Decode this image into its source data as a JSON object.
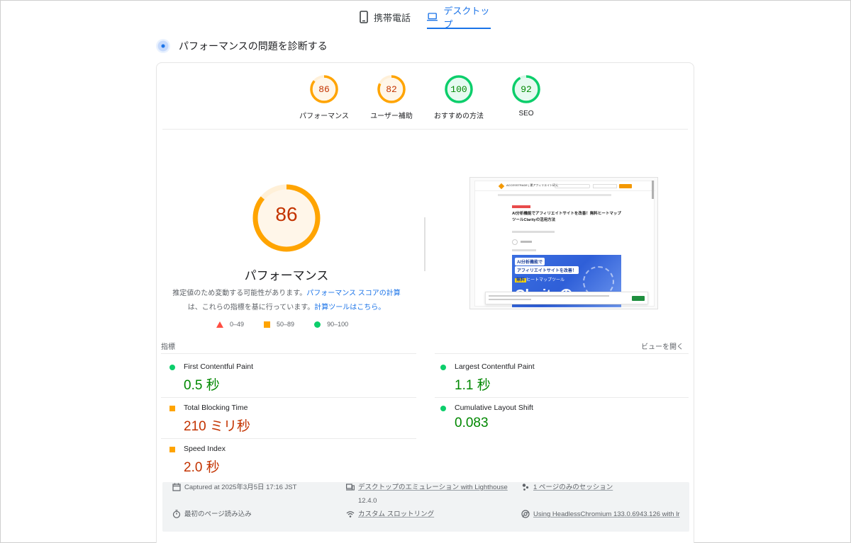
{
  "tabs": {
    "mobile": "携帯電話",
    "desktop": "デスクトップ"
  },
  "diagnose_title": "パフォーマンスの問題を診断する",
  "scores": [
    {
      "label": "パフォーマンス",
      "value": "86",
      "level": "average"
    },
    {
      "label": "ユーザー補助",
      "value": "82",
      "level": "average"
    },
    {
      "label": "おすすめの方法",
      "value": "100",
      "level": "pass"
    },
    {
      "label": "SEO",
      "value": "92",
      "level": "pass"
    }
  ],
  "main_score": {
    "value": "86",
    "title": "パフォーマンス"
  },
  "description": {
    "line1": "推定値のため変動する可能性があります。",
    "link1": "パフォーマンス スコアの計算",
    "line2": "は、これらの指標を基に行っています。",
    "link2": "計算ツールはこちら。"
  },
  "legend": {
    "fail": "0–49",
    "average": "50–89",
    "pass": "90–100"
  },
  "screenshot": {
    "brand": "ACCESSTRADE | 運アフィリエイト研究",
    "title": "AI分析機能でアフィリエイトサイトを改善！無料ヒートマップツールClarityの活用方法",
    "hero1": "AI分析機能で",
    "hero2": "アフィリエイトサイトを改善！",
    "hero_badge": "無料",
    "hero3": "ヒートマップツール",
    "hero4": "Clarityの"
  },
  "metrics": {
    "heading": "指標",
    "expand": "ビューを開く",
    "items": [
      {
        "name": "First Contentful Paint",
        "value": "0.5 秒",
        "level": "pass"
      },
      {
        "name": "Largest Contentful Paint",
        "value": "1.1 秒",
        "level": "pass"
      },
      {
        "name": "Total Blocking Time",
        "value": "210 ミリ秒",
        "level": "average"
      },
      {
        "name": "Cumulative Layout Shift",
        "value": "0.083",
        "level": "pass"
      },
      {
        "name": "Speed Index",
        "value": "2.0 秒",
        "level": "average"
      }
    ]
  },
  "info": {
    "captured": "Captured at 2025年3月5日 17:16 JST",
    "emulation": "デスクトップのエミュレーション with Lighthouse",
    "emulation_version": "12.4.0",
    "session": "1 ページのみのセッション",
    "load": "最初のページ読み込み",
    "throttling": "カスタム スロットリング",
    "browser": "Using HeadlessChromium 133.0.6943.126 with lr"
  },
  "colors": {
    "pass": "#0cce6b",
    "average": "#ffa400",
    "fail": "#ff4e42",
    "accent": "#1a73e8"
  }
}
